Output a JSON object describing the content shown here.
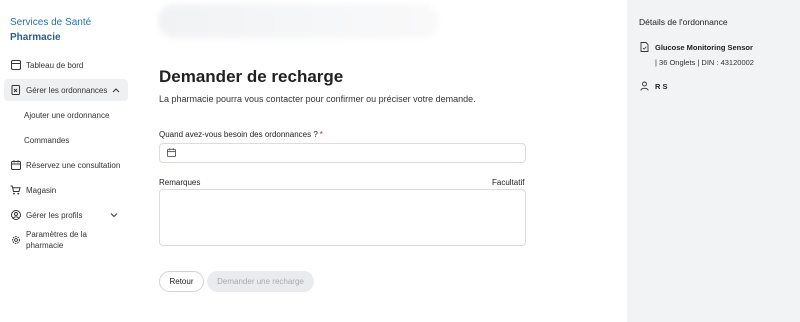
{
  "sidebar": {
    "brand": "Services de Santé",
    "brand_sub": "Pharmacie",
    "items": {
      "dashboard": "Tableau de bord",
      "manage_orders": "Gérer les ordonnances",
      "add_order": "Ajouter une ordonnance",
      "orders": "Commandes",
      "book_consult": "Réservez une consultation",
      "store": "Magasin",
      "manage_profiles": "Gérer les profils",
      "pharmacy_settings": "Paramètres de la pharmacie"
    }
  },
  "main": {
    "title": "Demander de recharge",
    "subtitle": "La pharmacie pourra vous contacter pour confirmer ou préciser votre demande.",
    "date_question": "Quand avez-vous besoin des ordonnances ?",
    "required_marker": "*",
    "remarks_label": "Remarques",
    "optional_label": "Facultatif",
    "back_button": "Retour",
    "request_button": "Demander une recharge"
  },
  "details": {
    "title": "Détails de l'ordonnance",
    "product_name": "Glucose Monitoring Sensor",
    "product_meta": "| 36 Onglets | DIN : 43120002",
    "patient_name": "R S"
  },
  "colors": {
    "brand": "#2a6fa8",
    "required": "#d3203f",
    "panel_bg": "#f2f3f5",
    "disabled_button_bg": "#e9ebee"
  },
  "icons": {
    "dashboard": "dashboard-icon",
    "manage_orders": "prescription-icon",
    "book_consult": "calendar-icon",
    "store": "cart-icon",
    "manage_profiles": "profile-icon",
    "pharmacy_settings": "gear-icon",
    "date_field": "calendar-icon",
    "product": "document-icon",
    "patient": "person-icon"
  }
}
